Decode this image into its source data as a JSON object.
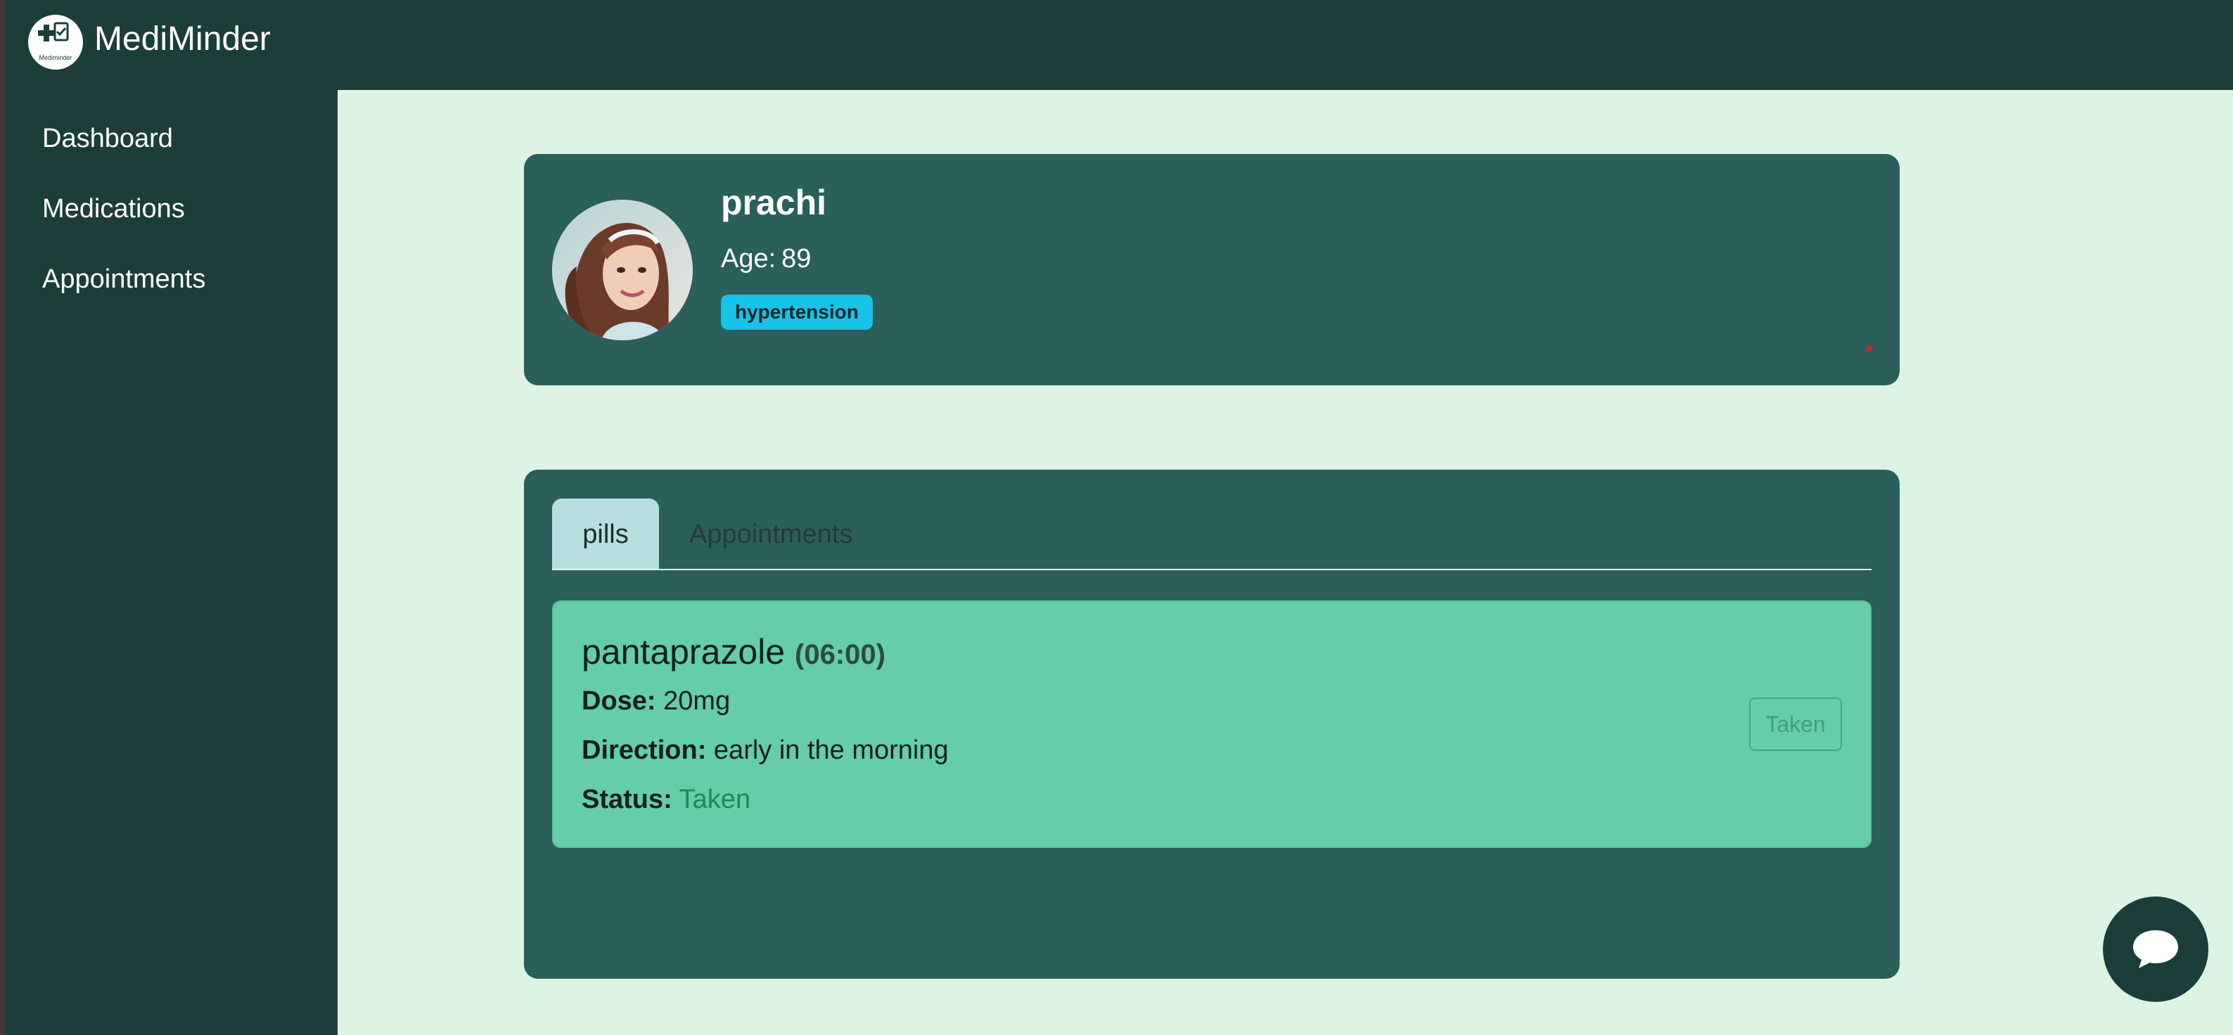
{
  "app": {
    "name": "MediMinder",
    "logo_text": "Mediminder"
  },
  "sidebar": {
    "items": [
      {
        "label": "Dashboard"
      },
      {
        "label": "Medications"
      },
      {
        "label": "Appointments"
      }
    ]
  },
  "profile": {
    "name": "prachi",
    "age_label": "Age:",
    "age": "89",
    "condition": "hypertension"
  },
  "tabs": [
    {
      "label": "pills",
      "active": true
    },
    {
      "label": "Appointments",
      "active": false
    }
  ],
  "medication": {
    "name": "pantaprazole",
    "time": "(06:00)",
    "dose_label": "Dose:",
    "dose": "20mg",
    "direction_label": "Direction:",
    "direction": "early in the morning",
    "status_label": "Status:",
    "status": "Taken",
    "action_label": "Taken"
  },
  "colors": {
    "header_bg": "#1c3d3a",
    "content_bg": "#ddf3e4",
    "card_bg": "#2a5f5a",
    "badge_bg": "#17c3e6",
    "med_card_bg": "#65cda8",
    "status_green": "#1c8a58"
  },
  "icons": {
    "logo": "medical-cross-clipboard-icon",
    "chat": "chat-bubble-icon"
  }
}
